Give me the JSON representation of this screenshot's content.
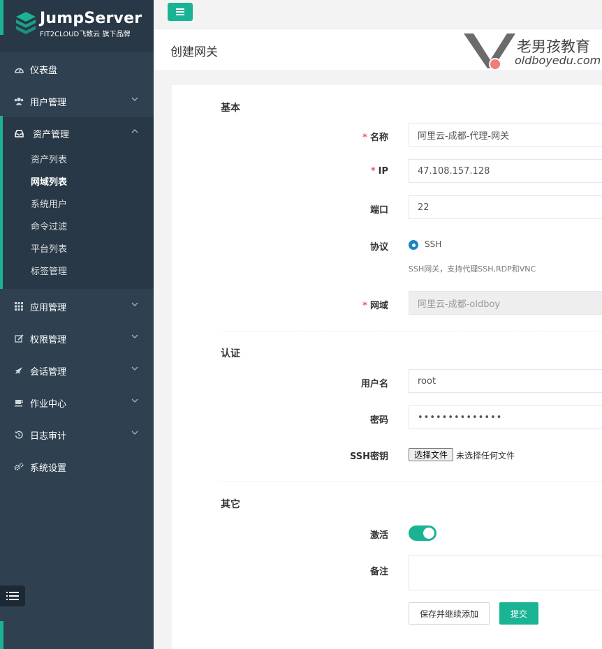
{
  "brand": {
    "name": "JumpServer",
    "tagline": "FIT2CLOUD飞致云 旗下品牌",
    "accent": "#1ab394",
    "sidebar_bg": "#2f4050"
  },
  "sidebar": {
    "items": [
      {
        "label": "仪表盘",
        "icon": "dashboard-icon"
      },
      {
        "label": "用户管理",
        "icon": "users-icon"
      },
      {
        "label": "资产管理",
        "icon": "inbox-icon"
      },
      {
        "label": "应用管理",
        "icon": "grid-icon"
      },
      {
        "label": "权限管理",
        "icon": "edit-icon"
      },
      {
        "label": "会话管理",
        "icon": "rocket-icon"
      },
      {
        "label": "作业中心",
        "icon": "coffee-icon"
      },
      {
        "label": "日志审计",
        "icon": "history-icon"
      },
      {
        "label": "系统设置",
        "icon": "gears-icon"
      }
    ],
    "asset_sub": [
      "资产列表",
      "网域列表",
      "系统用户",
      "命令过滤",
      "平台列表",
      "标签管理"
    ]
  },
  "page": {
    "title": "创建网关"
  },
  "watermark": {
    "text": "老男孩教育",
    "url": "oldboyedu.com"
  },
  "form": {
    "section_basic": "基本",
    "name_label": "名称",
    "name_value": "阿里云-成都-代理-网关",
    "ip_label": "IP",
    "ip_value": "47.108.157.128",
    "port_label": "端口",
    "port_value": "22",
    "protocol_label": "协议",
    "protocol_value": "SSH",
    "protocol_help": "SSH网关，支持代理SSH,RDP和VNC",
    "domain_label": "网域",
    "domain_value": "阿里云-成都-oldboy",
    "section_auth": "认证",
    "username_label": "用户名",
    "username_value": "root",
    "password_label": "密码",
    "password_value": "••••••••••••••",
    "sshkey_label": "SSH密钥",
    "file_button": "选择文件",
    "file_status": "未选择任何文件",
    "section_other": "其它",
    "active_label": "激活",
    "comment_label": "备注",
    "save_continue_label": "保存并继续添加",
    "submit_label": "提交",
    "required_mark": "*"
  }
}
